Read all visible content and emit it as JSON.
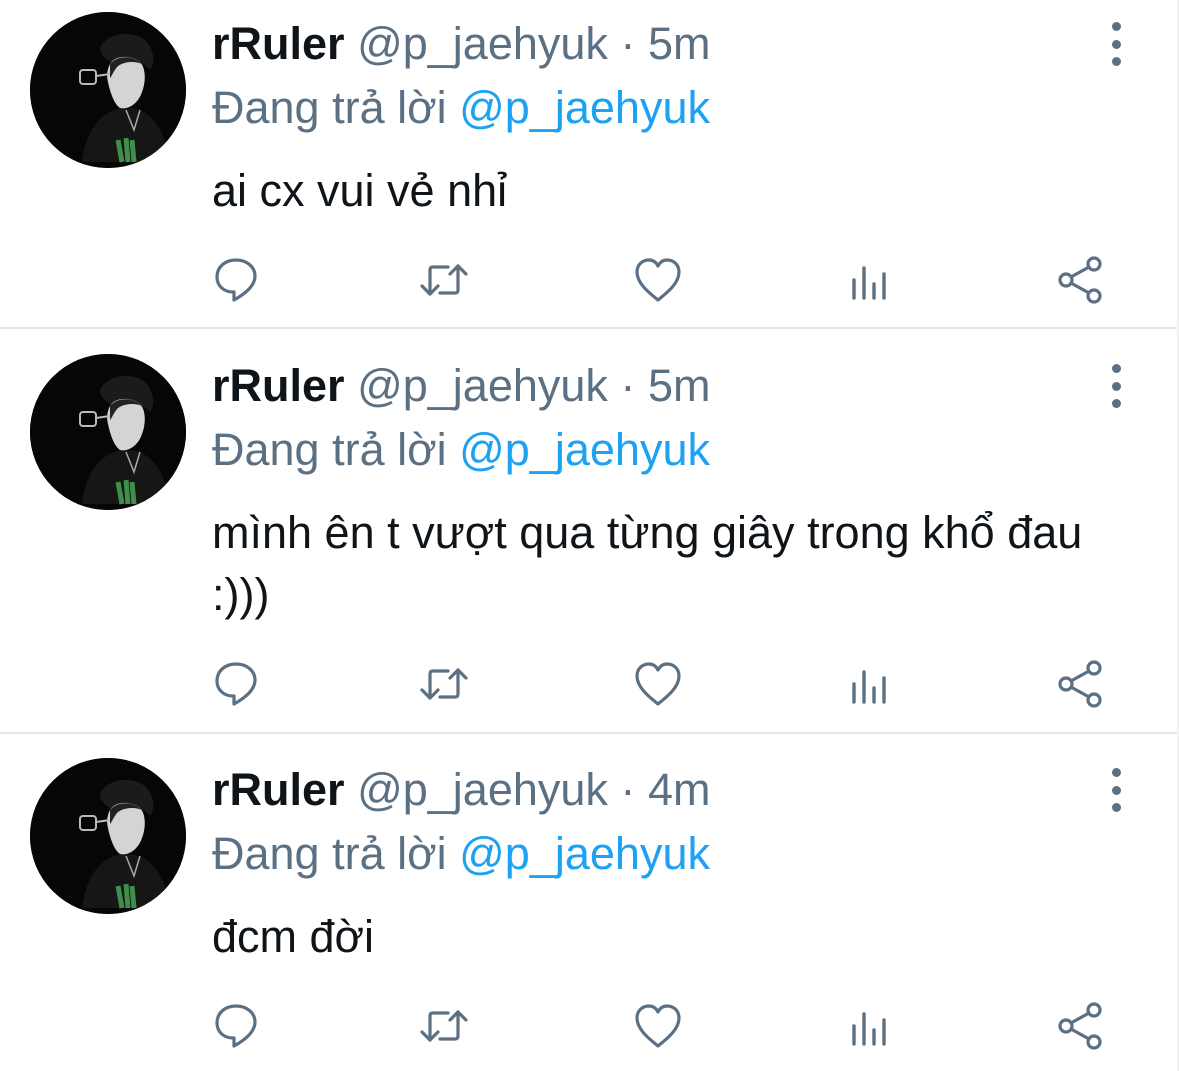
{
  "tweets": [
    {
      "name": "rRuler",
      "handle": "@p_jaehyuk",
      "separator": "·",
      "time": "5m",
      "reply_prefix": "Đang trả lời",
      "reply_to": "@p_jaehyuk",
      "text": "ai cx vui vẻ nhỉ"
    },
    {
      "name": "rRuler",
      "handle": "@p_jaehyuk",
      "separator": "·",
      "time": "5m",
      "reply_prefix": "Đang trả lời",
      "reply_to": "@p_jaehyuk",
      "text": "mình ên t vượt qua từng giây trong khổ đau :)))"
    },
    {
      "name": "rRuler",
      "handle": "@p_jaehyuk",
      "separator": "·",
      "time": "4m",
      "reply_prefix": "Đang trả lời",
      "reply_to": "@p_jaehyuk",
      "text": "đcm đời"
    }
  ],
  "actions": [
    "reply-icon",
    "retweet-icon",
    "like-icon",
    "analytics-icon",
    "share-icon"
  ],
  "colors": {
    "text": "#0f1419",
    "secondary": "#5b7083",
    "link": "#1da1f2",
    "divider": "#e1e8ed"
  }
}
